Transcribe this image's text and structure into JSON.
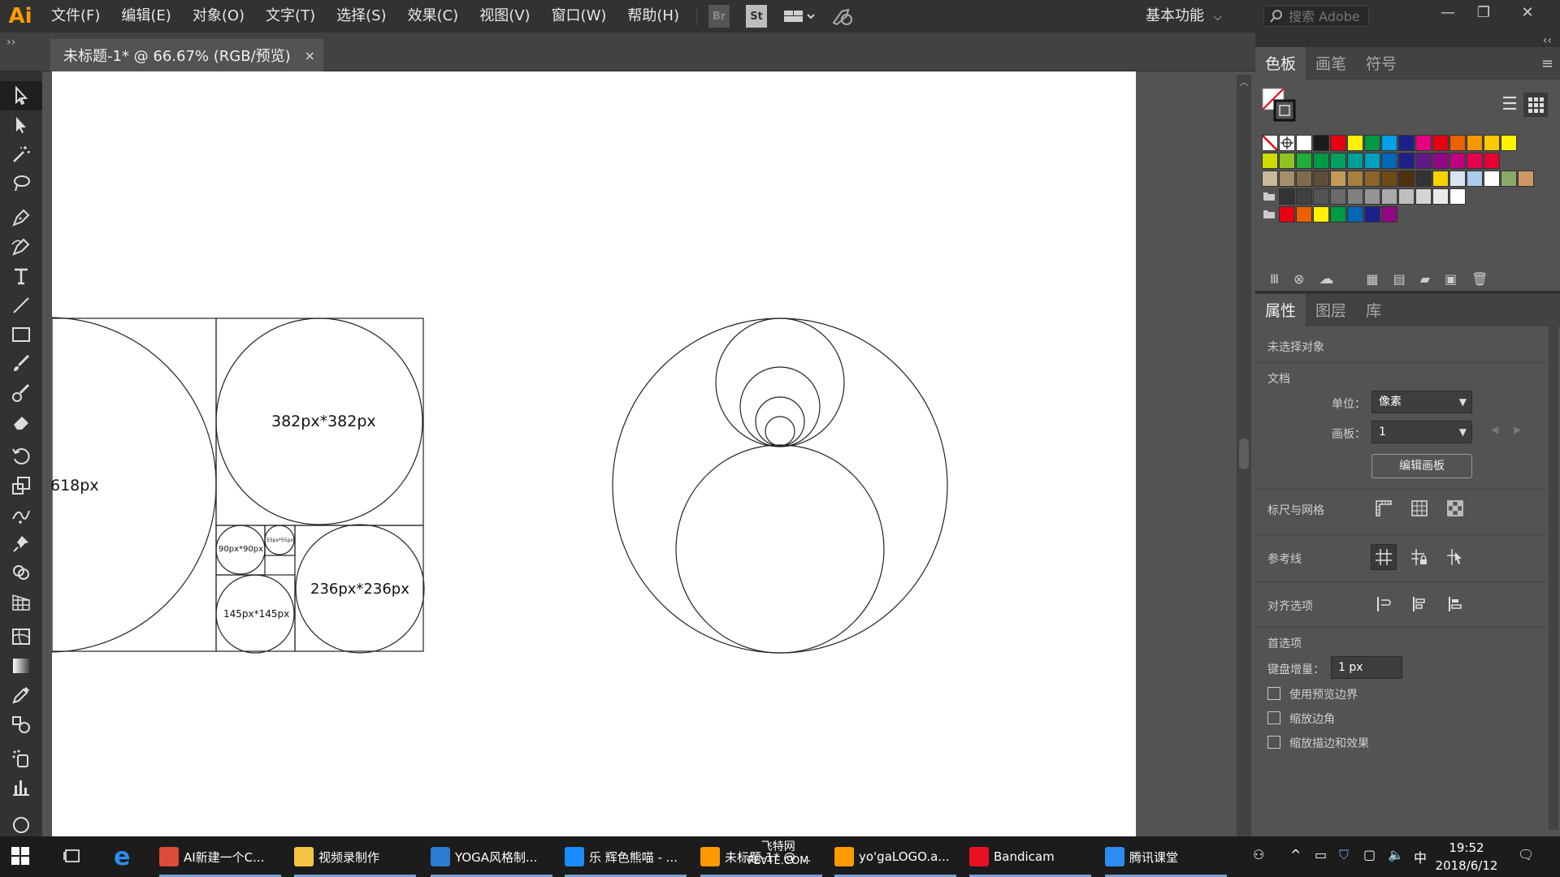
{
  "app": {
    "logo": "Ai"
  },
  "menu": [
    "文件(F)",
    "编辑(E)",
    "对象(O)",
    "文字(T)",
    "选择(S)",
    "效果(C)",
    "视图(V)",
    "窗口(W)",
    "帮助(H)"
  ],
  "toolbar_icons": {
    "br": "Br",
    "st": "St"
  },
  "workspace": "基本功能",
  "search": {
    "placeholder": "搜索 Adobe"
  },
  "document_tab": {
    "title": "未标题-1* @ 66.67% (RGB/预览)",
    "close": "×"
  },
  "artboard_labels": {
    "big": "618px",
    "c382": "382px*382px",
    "c236": "236px*236px",
    "c145": "145px*145px",
    "c90": "90px*90px",
    "c55": "55px*55px"
  },
  "swatch_panel": {
    "tabs": [
      "色板",
      "画笔",
      "符号"
    ],
    "rows": [
      [
        "#ffffff",
        "#ffffff",
        "#ffffff",
        "#1a1a1a",
        "#e60012",
        "#fff100",
        "#009944",
        "#00a0e9",
        "#1d2088",
        "#e4007f",
        "#e60012",
        "#eb6100",
        "#f39800",
        "#fcc800",
        "#fff100"
      ],
      [
        "#cfdb00",
        "#8fc31f",
        "#22ac38",
        "#009944",
        "#00a05e",
        "#009e96",
        "#00a0c1",
        "#0068b7",
        "#1d2088",
        "#601986",
        "#920783",
        "#be0081",
        "#e5004f",
        "#e60033"
      ],
      [
        "#c8b998",
        "#a58f6a",
        "#7f6b4e",
        "#5e4e36",
        "#c49a58",
        "#a97f3d",
        "#8c6427",
        "#6e4a16",
        "#4e2f0e",
        "#333333",
        "#f6d200",
        "#dbe5f1",
        "#aaccee",
        "#ffffff",
        "#88aa66",
        "#cc9966"
      ],
      [
        "#888888",
        "#333333",
        "#3f3f3f",
        "#545454",
        "#6a6a6a",
        "#808080",
        "#959595",
        "#aaaaaa",
        "#bfbfbf",
        "#d4d4d4",
        "#eaeaea",
        "#ffffff"
      ],
      [
        "#888888",
        "#e60012",
        "#eb6100",
        "#fff100",
        "#009944",
        "#0068b7",
        "#1d2088",
        "#920783"
      ]
    ]
  },
  "props_panel": {
    "tabs": [
      "属性",
      "图层",
      "库"
    ],
    "no_selection": "未选择对象",
    "doc_section": "文档",
    "unit_label": "单位：",
    "unit_value": "像素",
    "artboard_label": "画板：",
    "artboard_value": "1",
    "edit_artboard": "编辑画板",
    "rulers_grid": "标尺与网格",
    "guides": "参考线",
    "align_options": "对齐选项",
    "preferences": "首选项",
    "keyboard_inc_label": "键盘增量：",
    "keyboard_inc_value": "1 px",
    "chk_preview_bounds": "使用预览边界",
    "chk_scale_corners": "缩放边角",
    "chk_scale_strokes": "缩放描边和效果"
  },
  "taskbar": {
    "apps": [
      {
        "label": "AI新建一个C...",
        "color": "#dd4b39"
      },
      {
        "label": "视频录制作",
        "color": "#f4c542"
      },
      {
        "label": "YOGA风格制...",
        "color": "#2b7cd3"
      },
      {
        "label": "乐 辉色熊喵 - ...",
        "color": "#1a8cff"
      },
      {
        "label": "未标题-1* @ ...",
        "color": "#ff9a00"
      },
      {
        "label": "yo'gaLOGO.a...",
        "color": "#ff9a00"
      },
      {
        "label": "Bandicam",
        "color": "#e81123"
      },
      {
        "label": "腾讯课堂",
        "color": "#2d8cf0"
      }
    ],
    "watermark_top": "飞特网",
    "watermark_bottom": "FEVTE.COM",
    "ime": "中",
    "time": "19:52",
    "date": "2018/6/12"
  }
}
